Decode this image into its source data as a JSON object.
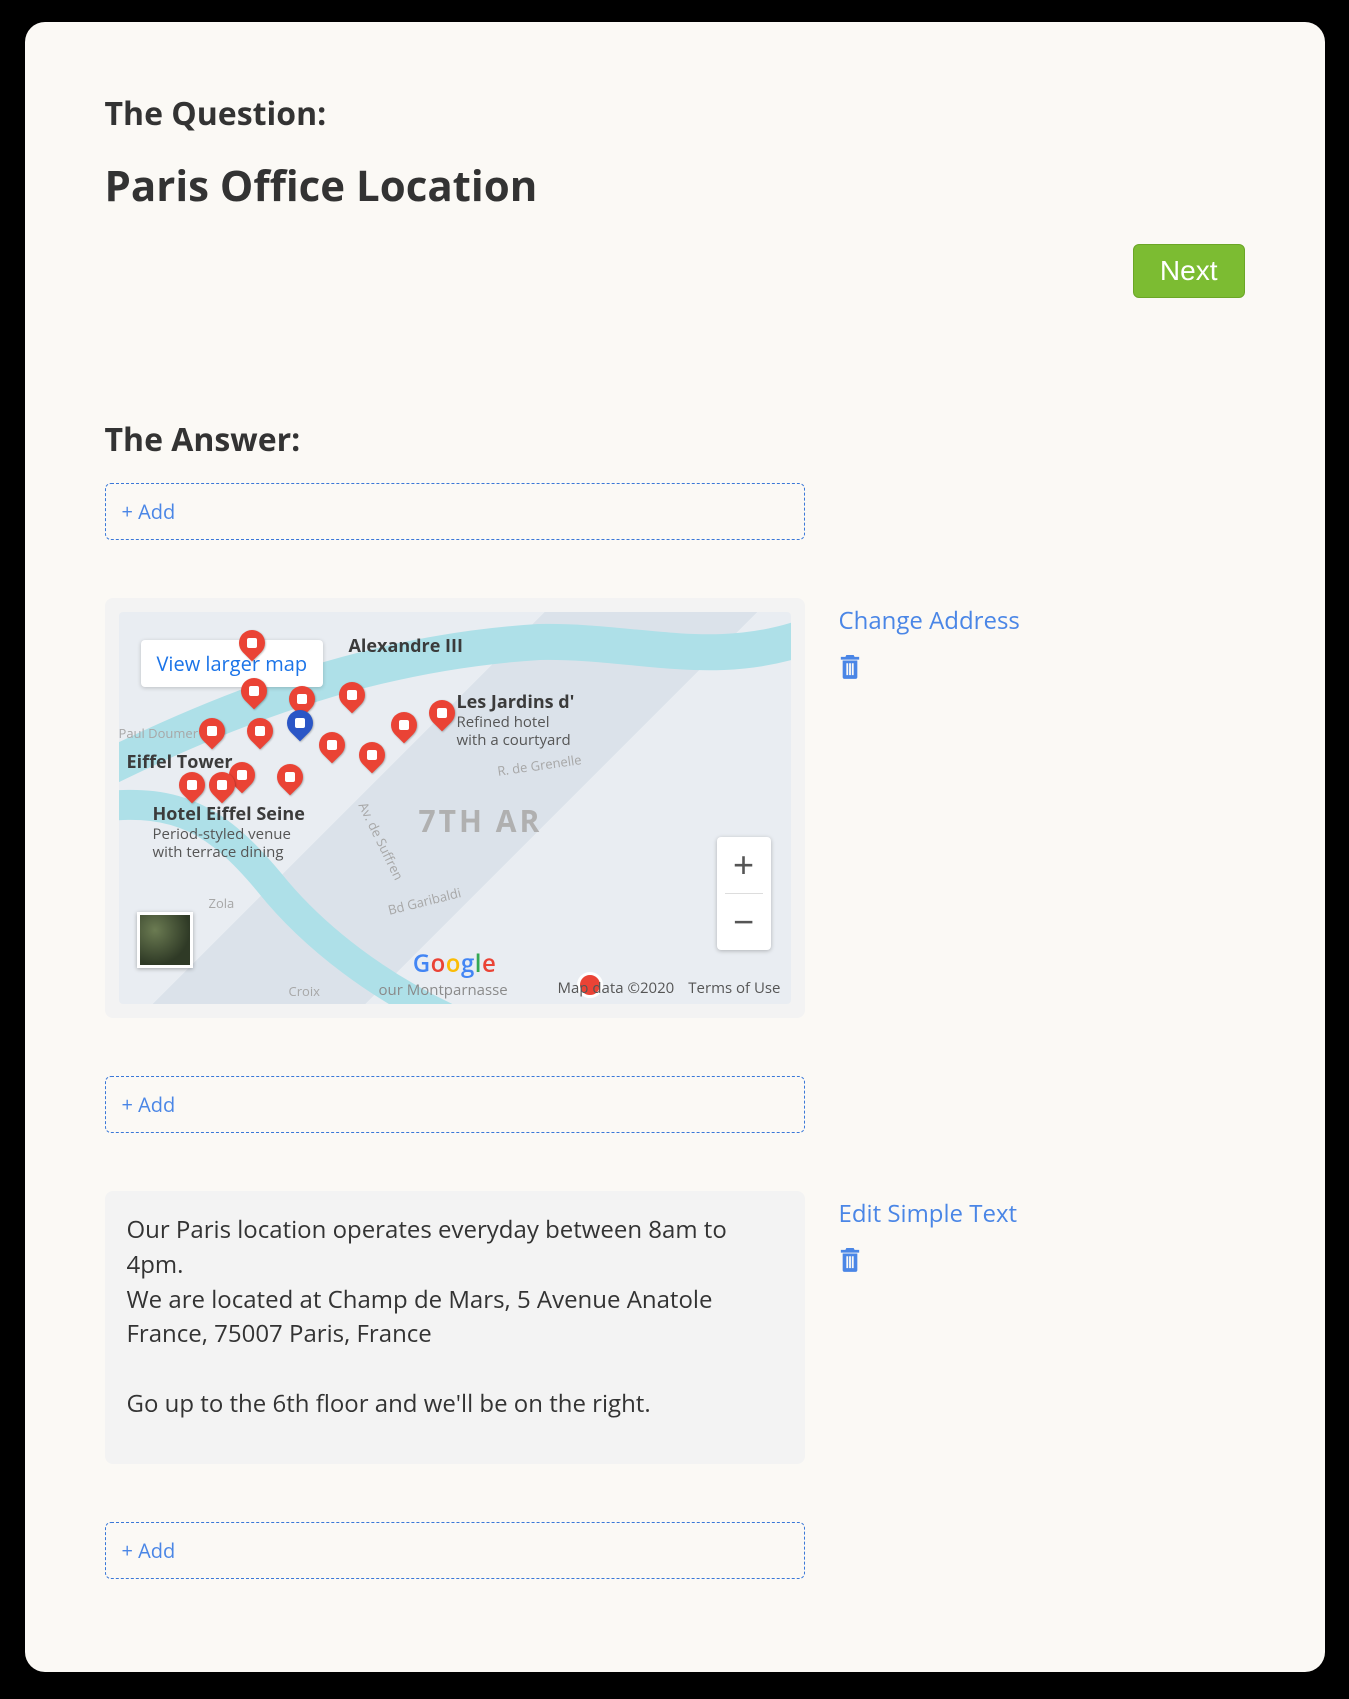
{
  "question": {
    "section_label": "The Question:",
    "title": "Paris Office Location",
    "next_label": "Next"
  },
  "answer": {
    "section_label": "The Answer:",
    "add_label": "+ Add",
    "blocks": {
      "map": {
        "action_label": "Change Address",
        "view_larger": "View larger map",
        "attribution": {
          "data": "Map data ©2020",
          "terms": "Terms of Use"
        },
        "district": "7TH AR",
        "poi": {
          "alexandre": "Alexandre III",
          "jardins": "Les Jardins d'",
          "jardins_sub1": "Refined hotel",
          "jardins_sub2": "with a courtyard",
          "eiffel": "Eiffel Tower",
          "hotel_seine": "Hotel Eiffel Seine",
          "hotel_seine_sub1": "Period-styled venue",
          "hotel_seine_sub2": "with terrace dining",
          "montparnasse": "our Montparnasse"
        },
        "streets": {
          "doumer": "Paul Doumer",
          "grenelle": "R. de Grenelle",
          "suffren": "Av. de Suffren",
          "garibaldi": "Bd Garibaldi",
          "zola": "Zola",
          "croix": "Croix"
        }
      },
      "text": {
        "action_label": "Edit Simple Text",
        "content": "Our Paris location operates everyday between 8am to 4pm.\nWe are located at Champ de Mars, 5 Avenue Anatole France, 75007 Paris, France\n\nGo up to the 6th floor and we'll be on the right."
      }
    }
  }
}
